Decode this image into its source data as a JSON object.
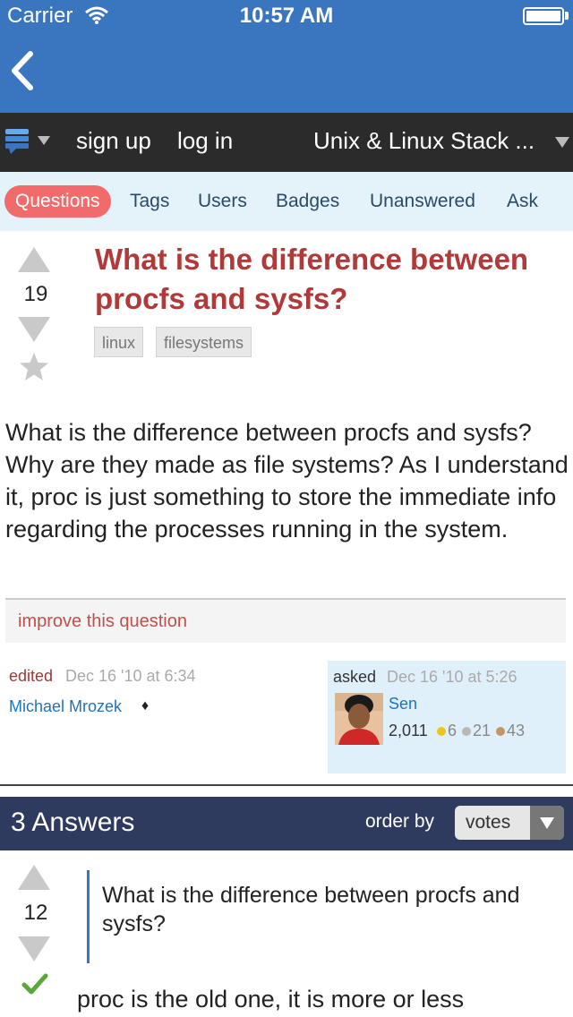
{
  "status_bar": {
    "carrier": "Carrier",
    "time": "10:57 AM"
  },
  "se_bar": {
    "sign_up": "sign up",
    "log_in": "log in",
    "site_name": "Unix & Linux Stack ..."
  },
  "tabs": [
    {
      "label": "Questions",
      "active": true
    },
    {
      "label": "Tags"
    },
    {
      "label": "Users"
    },
    {
      "label": "Badges"
    },
    {
      "label": "Unanswered"
    },
    {
      "label": "Ask"
    }
  ],
  "question": {
    "votes": "19",
    "title": "What is the difference between procfs and sysfs?",
    "tags": [
      "linux",
      "filesystems"
    ],
    "body": "What is the difference between procfs and sysfs? Why are they made as file systems? As I understand it, proc is just something to store the immediate info regarding the processes running in the system.",
    "improve_link": "improve this question",
    "edited": {
      "label": "edited",
      "date": "Dec 16 '10 at 6:34",
      "editor": "Michael Mrozek",
      "editor_badge": "♦"
    },
    "asked": {
      "label": "asked",
      "date": "Dec 16 '10 at 5:26",
      "owner": "Sen",
      "reputation": "2,011",
      "gold": "6",
      "silver": "21",
      "bronze": "43"
    }
  },
  "answers_header": {
    "count_label": "3 Answers",
    "order_by_label": "order by",
    "order_value": "votes"
  },
  "answer": {
    "votes": "12",
    "quote": "What is the difference between procfs and sysfs?",
    "body": "proc is the old one, it is more or less"
  },
  "colors": {
    "nav_blue": "#3a76c0",
    "se_bar": "#2b2b2b",
    "tab_bar": "#e4f3fa",
    "active_tab": "#f26b6b",
    "title_red": "#b03a3a",
    "answers_bar": "#2e3a5e",
    "link_blue": "#1e73be",
    "accepted_green": "#5aa83a"
  }
}
